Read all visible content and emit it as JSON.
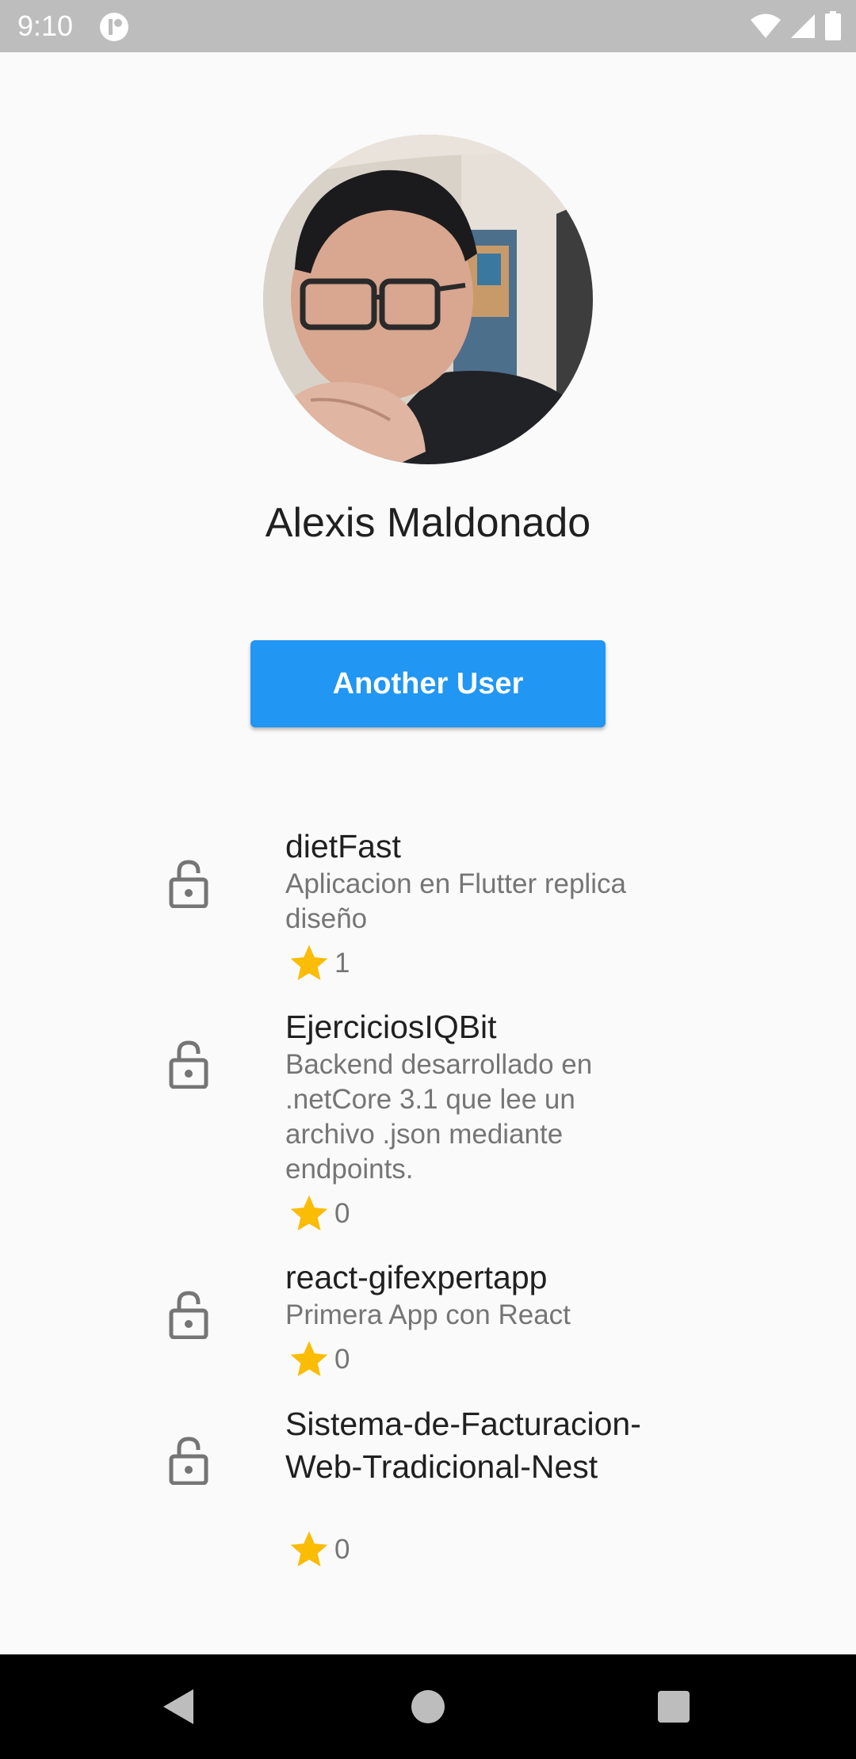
{
  "status_bar": {
    "time": "9:10",
    "icons": [
      "app-notification-icon",
      "wifi-icon",
      "cellular-signal-icon",
      "battery-icon"
    ]
  },
  "profile": {
    "name": "Alexis Maldonado",
    "avatar_icon": "profile-photo"
  },
  "actions": {
    "another_user_label": "Another User"
  },
  "colors": {
    "button": "#2196f3",
    "star": "#fbbc05",
    "background": "#fafafa",
    "status_bar": "#bdbdbd",
    "nav_bar": "#000000"
  },
  "repos": [
    {
      "name": "dietFast",
      "description": "Aplicacion en Flutter replica diseño",
      "stars": "1",
      "icon": "lock-open-icon"
    },
    {
      "name": "EjerciciosIQBit",
      "description": "Backend desarrollado en .netCore 3.1 que lee un archivo .json mediante endpoints.",
      "stars": "0",
      "icon": "lock-open-icon"
    },
    {
      "name": "react-gifexpertapp",
      "description": "Primera App con React",
      "stars": "0",
      "icon": "lock-open-icon"
    },
    {
      "name": "Sistema-de-Facturacion-Web-Tradicional-Nest",
      "description": "",
      "stars": "0",
      "icon": "lock-open-icon"
    }
  ],
  "nav": {
    "buttons": [
      "back-icon",
      "home-icon",
      "recents-icon"
    ]
  }
}
